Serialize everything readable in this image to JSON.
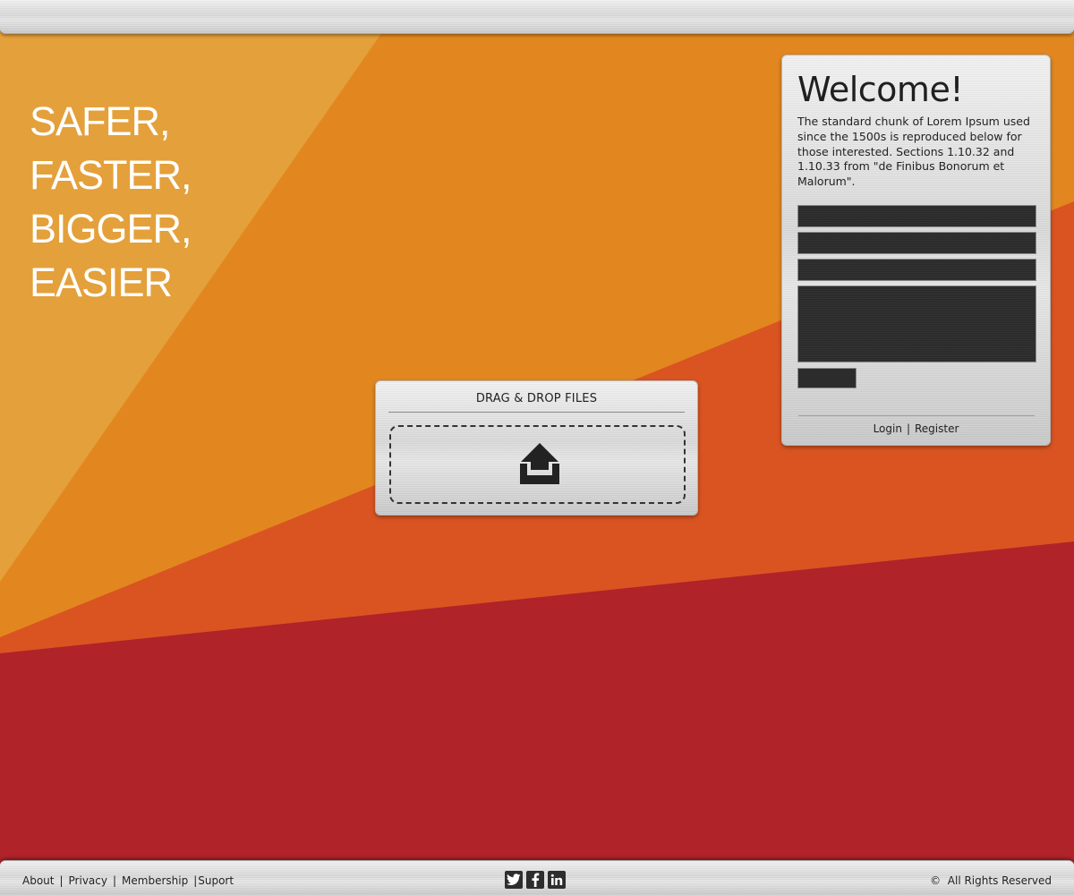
{
  "hero": {
    "lines": [
      "SAFER,",
      "FASTER,",
      "BIGGER,",
      "EASIER"
    ]
  },
  "welcome_panel": {
    "title": "Welcome!",
    "text": "The standard chunk of Lorem Ipsum used since the 1500s is reproduced below for those interested. Sections 1.10.32 and 1.10.33 from \"de Finibus Bonorum et Malorum\".",
    "fields": [
      "",
      "",
      ""
    ],
    "textarea_value": "",
    "submit_label": "",
    "login_label": "Login",
    "register_label": "Register",
    "separator": "|"
  },
  "drop_panel": {
    "title": "DRAG & DROP FILES",
    "icon": "upload-icon"
  },
  "footer": {
    "links": [
      "About",
      "Privacy",
      "Membership",
      "Suport"
    ],
    "separator": "|",
    "social_icons": [
      "twitter-icon",
      "facebook-icon",
      "linkedin-icon"
    ],
    "copyright_symbol": "©",
    "copyright_text": "All Rights Reserved"
  },
  "colors": {
    "yellow_orange": "#e4a03a",
    "orange": "#e2871f",
    "red_orange": "#da5422",
    "red": "#af2329",
    "metal": "#dcdcdc",
    "field_dark": "#2c2c2c"
  }
}
